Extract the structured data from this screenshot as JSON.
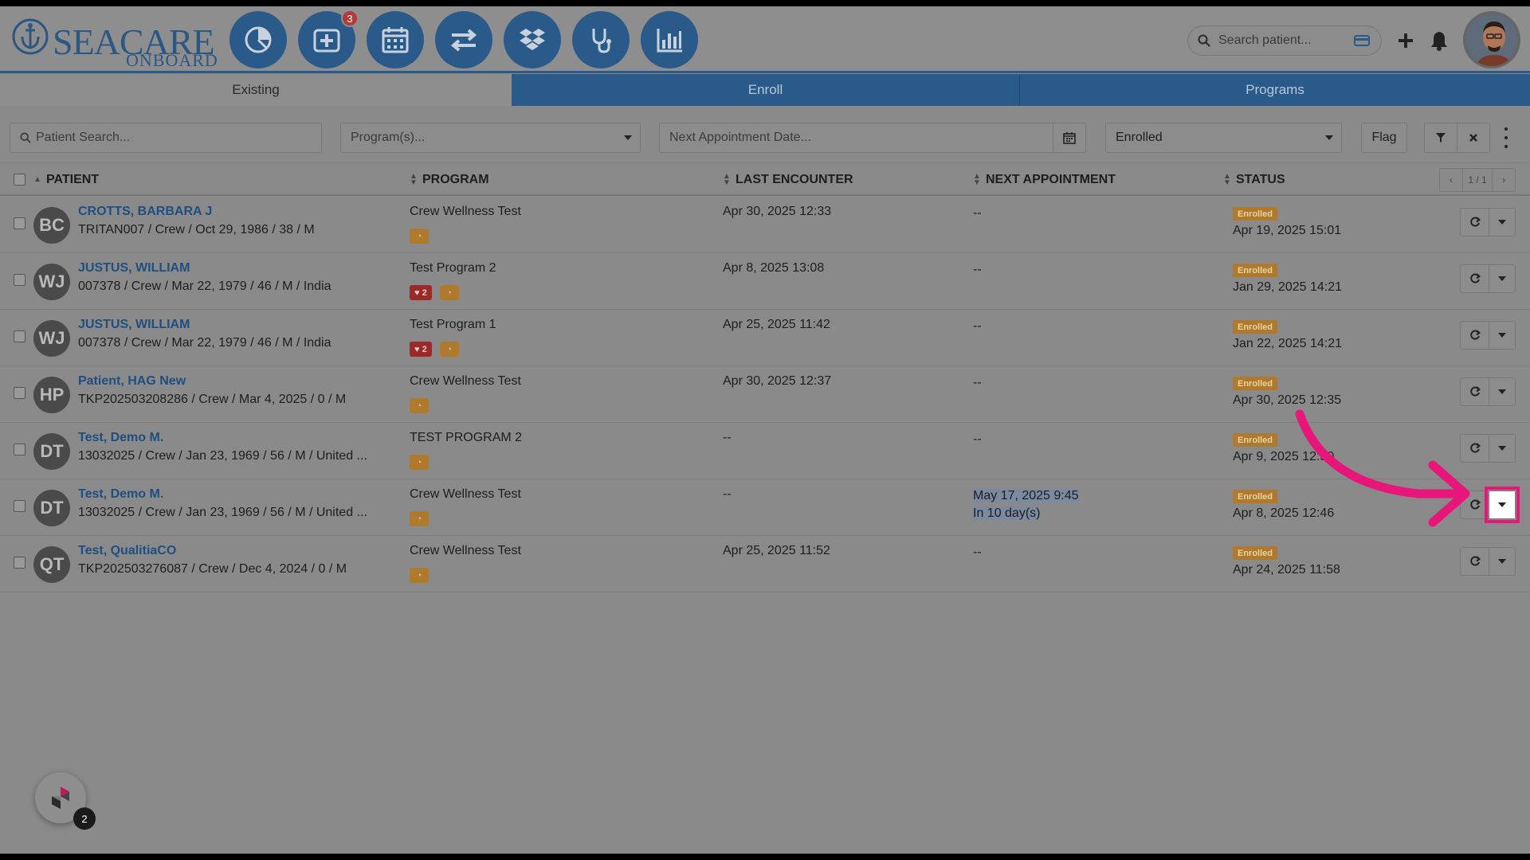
{
  "brand": {
    "name": "SEACARE",
    "sub": "ONBOARD"
  },
  "nav": [
    {
      "name": "dashboard-pie-icon"
    },
    {
      "name": "medical-cross-icon",
      "badge": "3"
    },
    {
      "name": "calendar-icon"
    },
    {
      "name": "transfer-arrows-icon"
    },
    {
      "name": "dropbox-icon"
    },
    {
      "name": "stethoscope-icon"
    },
    {
      "name": "bar-chart-icon"
    }
  ],
  "header": {
    "search_placeholder": "Search patient..."
  },
  "tabs": {
    "existing": "Existing",
    "enroll": "Enroll",
    "programs": "Programs"
  },
  "filters": {
    "patient_placeholder": "Patient Search...",
    "program_placeholder": "Program(s)...",
    "next_appt_placeholder": "Next Appointment Date...",
    "status_value": "Enrolled",
    "flag_label": "Flag"
  },
  "columns": {
    "patient": "PATIENT",
    "program": "PROGRAM",
    "last_encounter": "LAST ENCOUNTER",
    "next_appointment": "NEXT APPOINTMENT",
    "status": "STATUS"
  },
  "pager": {
    "prev": "‹",
    "page": "1 / 1",
    "next": "›"
  },
  "rows": [
    {
      "initials": "BC",
      "name": "CROTTS, BARBARA J",
      "details": "TRITAN007 / Crew / Oct 29, 1986 / 38 / M",
      "program": "Crew Wellness Test",
      "hearts": "",
      "last": "Apr 30, 2025 12:33",
      "next1": "--",
      "next2": "",
      "status": "Enrolled",
      "status_date": "Apr 19, 2025 15:01"
    },
    {
      "initials": "WJ",
      "name": "JUSTUS, WILLIAM",
      "details": "007378 / Crew / Mar 22, 1979 / 46 / M / India",
      "program": "Test Program 2",
      "hearts": "♥ 2",
      "last": "Apr 8, 2025 13:08",
      "next1": "--",
      "next2": "",
      "status": "Enrolled",
      "status_date": "Jan 29, 2025 14:21"
    },
    {
      "initials": "WJ",
      "name": "JUSTUS, WILLIAM",
      "details": "007378 / Crew / Mar 22, 1979 / 46 / M / India",
      "program": "Test Program 1",
      "hearts": "♥ 2",
      "last": "Apr 25, 2025 11:42",
      "next1": "--",
      "next2": "",
      "status": "Enrolled",
      "status_date": "Jan 22, 2025 14:21"
    },
    {
      "initials": "HP",
      "name": "Patient, HAG New",
      "details": "TKP202503208286 / Crew / Mar 4, 2025 / 0 / M",
      "program": "Crew Wellness Test",
      "hearts": "",
      "last": "Apr 30, 2025 12:37",
      "next1": "--",
      "next2": "",
      "status": "Enrolled",
      "status_date": "Apr 30, 2025 12:35"
    },
    {
      "initials": "DT",
      "name": "Test, Demo M.",
      "details": "13032025 / Crew / Jan 23, 1969 / 56 / M / United ...",
      "program": "TEST PROGRAM 2",
      "hearts": "",
      "last": "--",
      "next1": "--",
      "next2": "",
      "status": "Enrolled",
      "status_date": "Apr 9, 2025 12:50"
    },
    {
      "initials": "DT",
      "name": "Test, Demo M.",
      "details": "13032025 / Crew / Jan 23, 1969 / 56 / M / United ...",
      "program": "Crew Wellness Test",
      "hearts": "",
      "last": "--",
      "next1": "May 17, 2025 9:45",
      "next2": "In 10 day(s)",
      "status": "Enrolled",
      "status_date": "Apr 8, 2025 12:46"
    },
    {
      "initials": "QT",
      "name": "Test, QualitiaCO",
      "details": "TKP202503276087 / Crew / Dec 4, 2024 / 0 / M",
      "program": "Crew Wellness Test",
      "hearts": "",
      "last": "Apr 25, 2025 11:52",
      "next1": "--",
      "next2": "",
      "status": "Enrolled",
      "status_date": "Apr 24, 2025 11:58"
    }
  ],
  "widget": {
    "badge": "2"
  },
  "colors": {
    "primary": "#2a5a8a",
    "link": "#1f4f80",
    "status_badge": "#b07a2e",
    "annotation": "#e8157a"
  }
}
